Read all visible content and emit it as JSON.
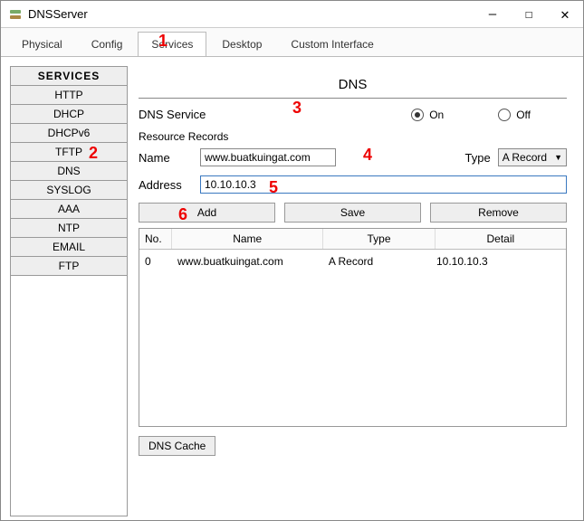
{
  "window": {
    "title": "DNSServer"
  },
  "tabs": [
    {
      "label": "Physical",
      "active": false
    },
    {
      "label": "Config",
      "active": false
    },
    {
      "label": "Services",
      "active": true
    },
    {
      "label": "Desktop",
      "active": false
    },
    {
      "label": "Custom Interface",
      "active": false
    }
  ],
  "sidebar": {
    "header": "SERVICES",
    "items": [
      "HTTP",
      "DHCP",
      "DHCPv6",
      "TFTP",
      "DNS",
      "SYSLOG",
      "AAA",
      "NTP",
      "EMAIL",
      "FTP"
    ]
  },
  "dns": {
    "title": "DNS",
    "service_label": "DNS Service",
    "on_label": "On",
    "off_label": "Off",
    "selected": "On",
    "resource_records_label": "Resource Records",
    "name_label": "Name",
    "name_value": "www.buatkuingat.com",
    "type_label": "Type",
    "type_value": "A Record",
    "address_label": "Address",
    "address_value": "10.10.10.3",
    "buttons": {
      "add": "Add",
      "save": "Save",
      "remove": "Remove"
    },
    "table": {
      "headers": {
        "no": "No.",
        "name": "Name",
        "type": "Type",
        "detail": "Detail"
      },
      "rows": [
        {
          "no": "0",
          "name": "www.buatkuingat.com",
          "type": "A Record",
          "detail": "10.10.10.3"
        }
      ]
    },
    "cache_button": "DNS Cache"
  },
  "annotations": [
    "1",
    "2",
    "3",
    "4",
    "5",
    "6"
  ]
}
